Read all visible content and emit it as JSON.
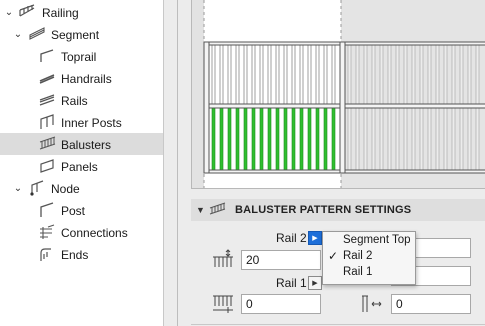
{
  "tree": {
    "items": [
      {
        "label": "Railing",
        "icon": "railing-icon",
        "expanded": true
      },
      {
        "label": "Segment",
        "icon": "segment-icon",
        "expanded": true
      },
      {
        "label": "Toprail",
        "icon": "toprail-icon"
      },
      {
        "label": "Handrails",
        "icon": "handrails-icon"
      },
      {
        "label": "Rails",
        "icon": "rails-icon"
      },
      {
        "label": "Inner Posts",
        "icon": "inner-posts-icon"
      },
      {
        "label": "Balusters",
        "icon": "balusters-icon",
        "selected": true
      },
      {
        "label": "Panels",
        "icon": "panels-icon"
      },
      {
        "label": "Node",
        "icon": "node-icon",
        "expanded": true
      },
      {
        "label": "Post",
        "icon": "post-icon"
      },
      {
        "label": "Connections",
        "icon": "connections-icon"
      },
      {
        "label": "Ends",
        "icon": "ends-icon"
      }
    ]
  },
  "section": {
    "title": "BALUSTER PATTERN SETTINGS",
    "icon": "baluster-pattern-icon"
  },
  "fields": {
    "rail2_label": "Rail 2",
    "rail2_value": "20",
    "rail1_label": "Rail 1",
    "rail1_value": "0",
    "right_top_value": "",
    "right_mid_value": "",
    "right_bottom_value": "0"
  },
  "popup": {
    "items": [
      {
        "label": "Segment Top",
        "checked": false
      },
      {
        "label": "Rail 2",
        "checked": true
      },
      {
        "label": "Rail 1",
        "checked": false
      }
    ],
    "check_glyph": "✓"
  },
  "colors": {
    "selected_row": "#dcdcdc",
    "highlight_balusters": "#2fbf2f",
    "accent_button": "#1e6fd9"
  }
}
